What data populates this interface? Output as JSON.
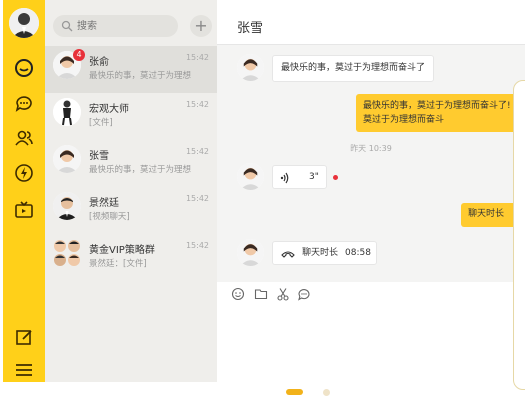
{
  "search": {
    "placeholder": "搜索"
  },
  "add_button": {
    "label": "+"
  },
  "conversations": [
    {
      "name": "张俞",
      "time": "15:42",
      "preview": "最快乐的事，莫过于为理想",
      "badge": "4"
    },
    {
      "name": "宏观大师",
      "time": "15:42",
      "preview": "[文件]"
    },
    {
      "name": "张雪",
      "time": "15:42",
      "preview": "最快乐的事，莫过于为理想"
    },
    {
      "name": "景然廷",
      "time": "15:42",
      "preview": "[视频聊天]"
    },
    {
      "name": "黄金VIP策略群",
      "time": "15:42",
      "preview": "景然廷：[文件]"
    }
  ],
  "chat": {
    "title": "张雪",
    "messages": {
      "m1": "最快乐的事，莫过于为理想而奋斗了",
      "m2_line1": "最快乐的事，莫过于为理想而奋斗了!",
      "m2_line2": "莫过于为理想而奋斗",
      "timestamp": "昨天 10:39",
      "voice_duration": "3\"",
      "video_out": "聊天时长",
      "call_label": "聊天时长",
      "call_duration": "08:58"
    }
  },
  "colors": {
    "accent": "#ffd019",
    "bubble_out": "#ffcb2f",
    "unread": "#e8313a"
  }
}
